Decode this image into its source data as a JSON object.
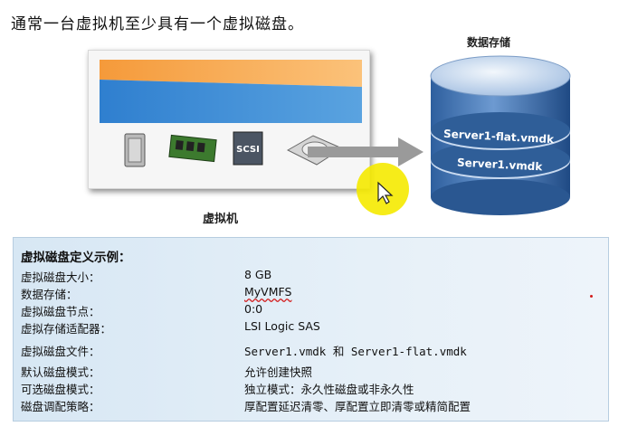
{
  "title": "通常一台虚拟机至少具有一个虚拟磁盘。",
  "vm": {
    "label": "虚拟机",
    "scsi_text": "SCSI"
  },
  "datastore": {
    "label": "数据存储",
    "file_flat": "Server1-flat.vmdk",
    "file_vmdk": "Server1.vmdk"
  },
  "example": {
    "heading": "虚拟磁盘定义示例：",
    "rows": [
      {
        "label": "虚拟磁盘大小：",
        "value": "8 GB"
      },
      {
        "label": "数据存储：",
        "value": "MyVMFS"
      },
      {
        "label": "虚拟磁盘节点：",
        "value": "0:0"
      },
      {
        "label": "虚拟存储适配器：",
        "value": "LSI Logic SAS"
      },
      {
        "label": "虚拟磁盘文件：",
        "value": "Server1.vmdk 和 Server1-flat.vmdk"
      },
      {
        "label": "默认磁盘模式：",
        "value": "允许创建快照"
      },
      {
        "label": "可选磁盘模式：",
        "value": "独立模式：永久性磁盘或非永久性"
      },
      {
        "label": "磁盘调配策略：",
        "value": "厚配置延迟清零、厚配置立即清零或精简配置"
      }
    ]
  },
  "colors": {
    "orange": "#f7a44a",
    "blue": "#2f7fcf",
    "datastore_blue": "#3b6fae",
    "info_bg": "#dbe9f5",
    "cursor_yellow": "#f5ea00"
  }
}
